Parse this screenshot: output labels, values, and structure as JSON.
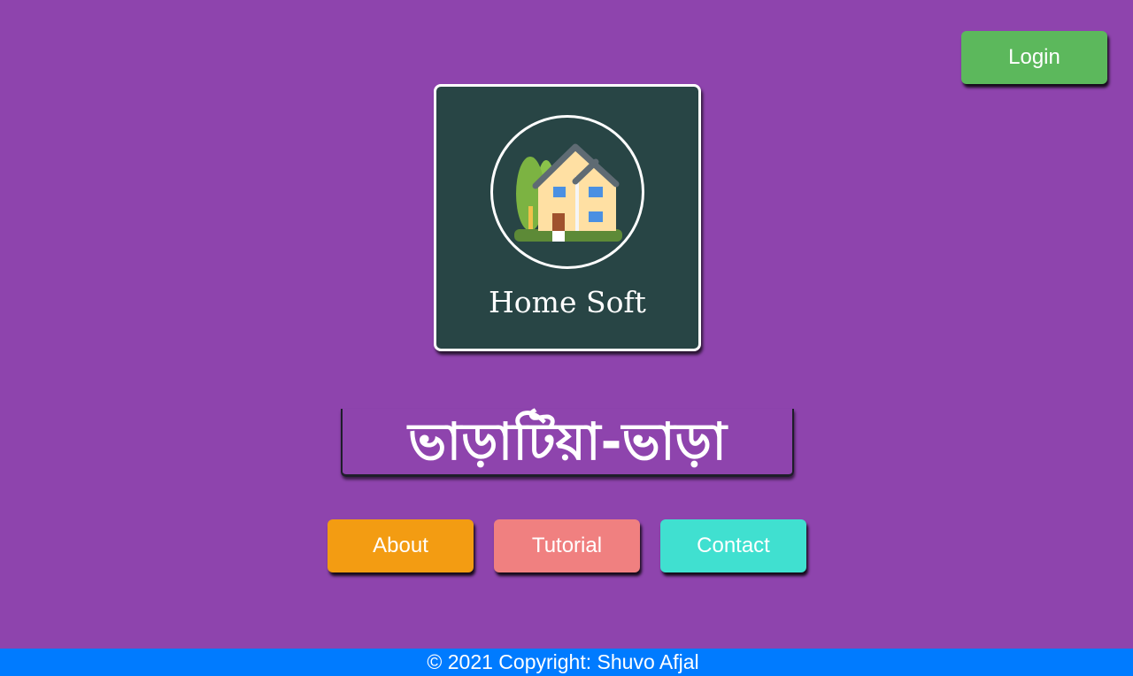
{
  "header": {
    "login_label": "Login"
  },
  "logo": {
    "icon": "house-icon",
    "brand_name": "Home Soft"
  },
  "main": {
    "title": "ভাড়াটিয়া-ভাড়া"
  },
  "nav": {
    "about_label": "About",
    "tutorial_label": "Tutorial",
    "contact_label": "Contact"
  },
  "footer": {
    "copyright": "© 2021 Copyright: Shuvo Afjal"
  },
  "colors": {
    "background": "#8e44ad",
    "login": "#5cb85c",
    "about": "#f39c12",
    "tutorial": "#f08080",
    "contact": "#40e0d0",
    "footer": "#007bff",
    "logo_card": "#284545"
  }
}
